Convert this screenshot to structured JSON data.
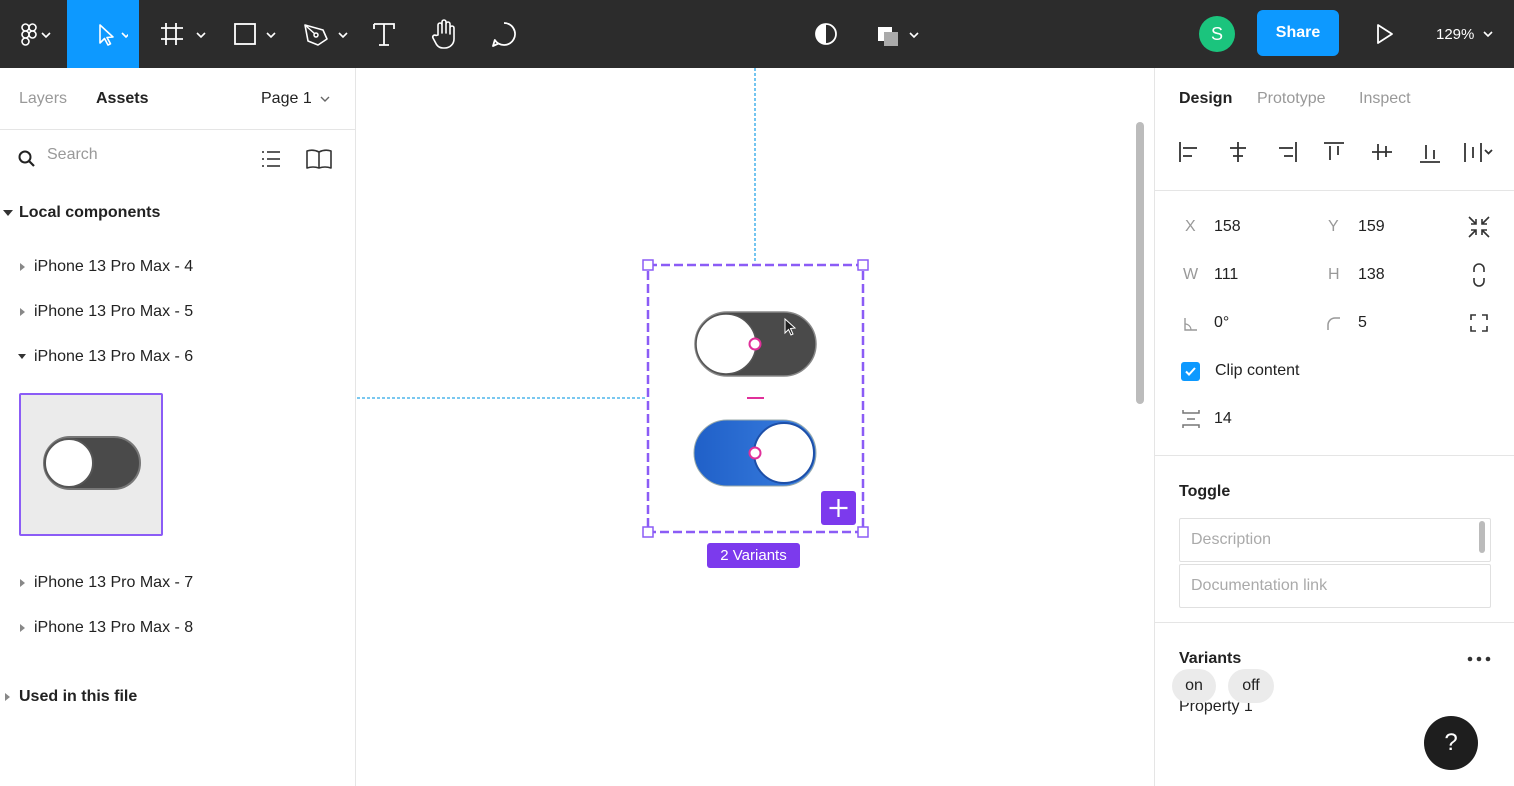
{
  "toolbar": {
    "share_label": "Share",
    "avatar_initial": "S",
    "zoom": "129%",
    "accent": "#0d99ff",
    "icons": [
      "figma-menu-icon",
      "move-icon",
      "frame-icon",
      "rectangle-icon",
      "pen-icon",
      "text-icon",
      "hand-icon",
      "comment-icon",
      "contrast-icon",
      "components-icon",
      "play-icon"
    ]
  },
  "left_panel": {
    "tabs": [
      "Layers",
      "Assets"
    ],
    "active_tab": "Assets",
    "page": "Page 1",
    "search_placeholder": "Search",
    "local_components_title": "Local components",
    "components": [
      {
        "label": "iPhone 13 Pro Max - 4",
        "expanded": false
      },
      {
        "label": "iPhone 13 Pro Max - 5",
        "expanded": false
      },
      {
        "label": "iPhone 13 Pro Max - 6",
        "expanded": true
      },
      {
        "label": "iPhone 13 Pro Max - 7",
        "expanded": false
      },
      {
        "label": "iPhone 13 Pro Max - 8",
        "expanded": false
      }
    ],
    "used_title": "Used in this file"
  },
  "canvas": {
    "selection_label": "2 Variants",
    "selection_color": "#8b5cf6",
    "toggle_on_color": "#2563c9",
    "toggle_off_color": "#4a4a4a"
  },
  "right_panel": {
    "tabs": [
      "Design",
      "Prototype",
      "Inspect"
    ],
    "active_tab": "Design",
    "x_label": "X",
    "x": "158",
    "y_label": "Y",
    "y": "159",
    "w_label": "W",
    "w": "111",
    "h_label": "H",
    "h": "138",
    "rotation": "0°",
    "radius": "5",
    "clip_content_label": "Clip content",
    "clip_content": true,
    "spacing": "14",
    "component_title": "Toggle",
    "description_placeholder": "Description",
    "doc_link_placeholder": "Documentation link",
    "variants_title": "Variants",
    "property_label": "Property 1",
    "property_values": [
      "on",
      "off"
    ],
    "help_label": "?"
  }
}
